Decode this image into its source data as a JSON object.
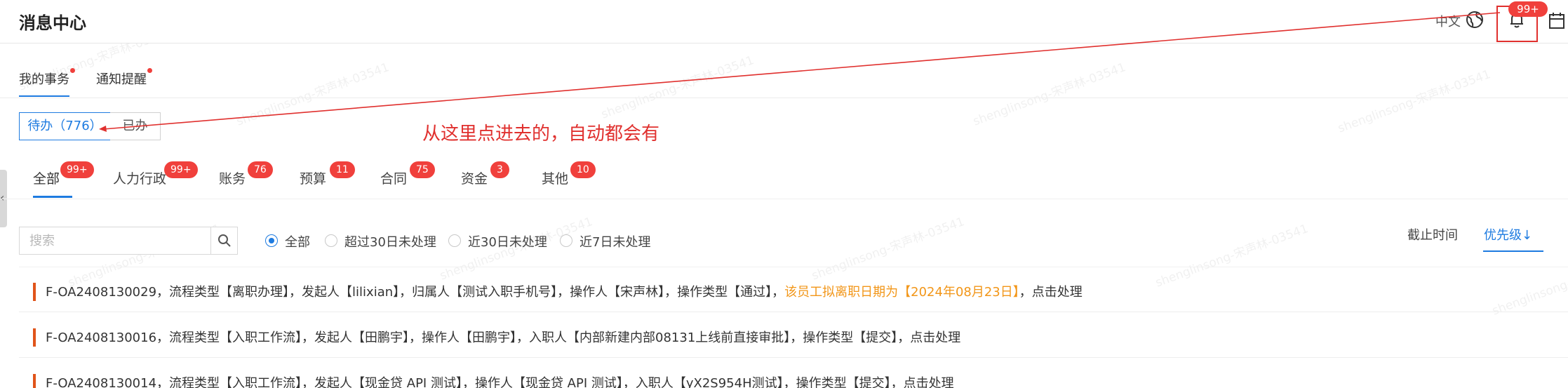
{
  "header": {
    "title": "消息中心",
    "lang": "中文",
    "bell_badge": "99+",
    "icons": [
      "globe-icon",
      "bell-icon",
      "calendar-icon"
    ]
  },
  "top_tabs": [
    {
      "label": "我的事务",
      "active": true,
      "dot": true
    },
    {
      "label": "通知提醒",
      "active": false,
      "dot": true
    }
  ],
  "segment": {
    "todo": "待办（776）",
    "done": "已办"
  },
  "annotation": "从这里点进去的，自动都会有",
  "categories": [
    {
      "label": "全部",
      "badge": "99+",
      "active": true
    },
    {
      "label": "人力行政",
      "badge": "99+"
    },
    {
      "label": "账务",
      "badge": "76"
    },
    {
      "label": "预算",
      "badge": "11"
    },
    {
      "label": "合同",
      "badge": "75"
    },
    {
      "label": "资金",
      "badge": "3"
    },
    {
      "label": "其他",
      "badge": "10"
    }
  ],
  "search": {
    "placeholder": "搜索"
  },
  "filters": [
    {
      "label": "全部",
      "checked": true
    },
    {
      "label": "超过30日未处理",
      "checked": false
    },
    {
      "label": "近30日未处理",
      "checked": false
    },
    {
      "label": "近7日未处理",
      "checked": false
    }
  ],
  "sort": {
    "deadline": "截止时间",
    "priority": "优先级↓"
  },
  "items": [
    {
      "text": "F-OA2408130029，流程类型【离职办理】，发起人【lilixian】，归属人【测试入职手机号】，操作人【宋声林】，操作类型【通过】，",
      "highlight": "该员工拟离职日期为【2024年08月23日】",
      "tail": "，点击处理"
    },
    {
      "text": "F-OA2408130016，流程类型【入职工作流】，发起人【田鹏宇】，操作人【田鹏宇】，入职人【内部新建内部08131上线前直接审批】，操作类型【提交】，点击处理",
      "highlight": "",
      "tail": ""
    },
    {
      "text": "F-OA2408130014，流程类型【入职工作流】，发起人【现金贷 API 测试】，操作人【现金贷 API 测试】，入职人【yX2S954H测试】，操作类型【提交】，点击处理",
      "highlight": "",
      "tail": ""
    }
  ],
  "watermark": "shenglinsong-宋声林-03541",
  "colors": {
    "accent": "#1e7be0",
    "badge": "#f0403c",
    "annotation": "#e0302e",
    "highlight": "#f29618",
    "row_bar": "#e0541a"
  }
}
